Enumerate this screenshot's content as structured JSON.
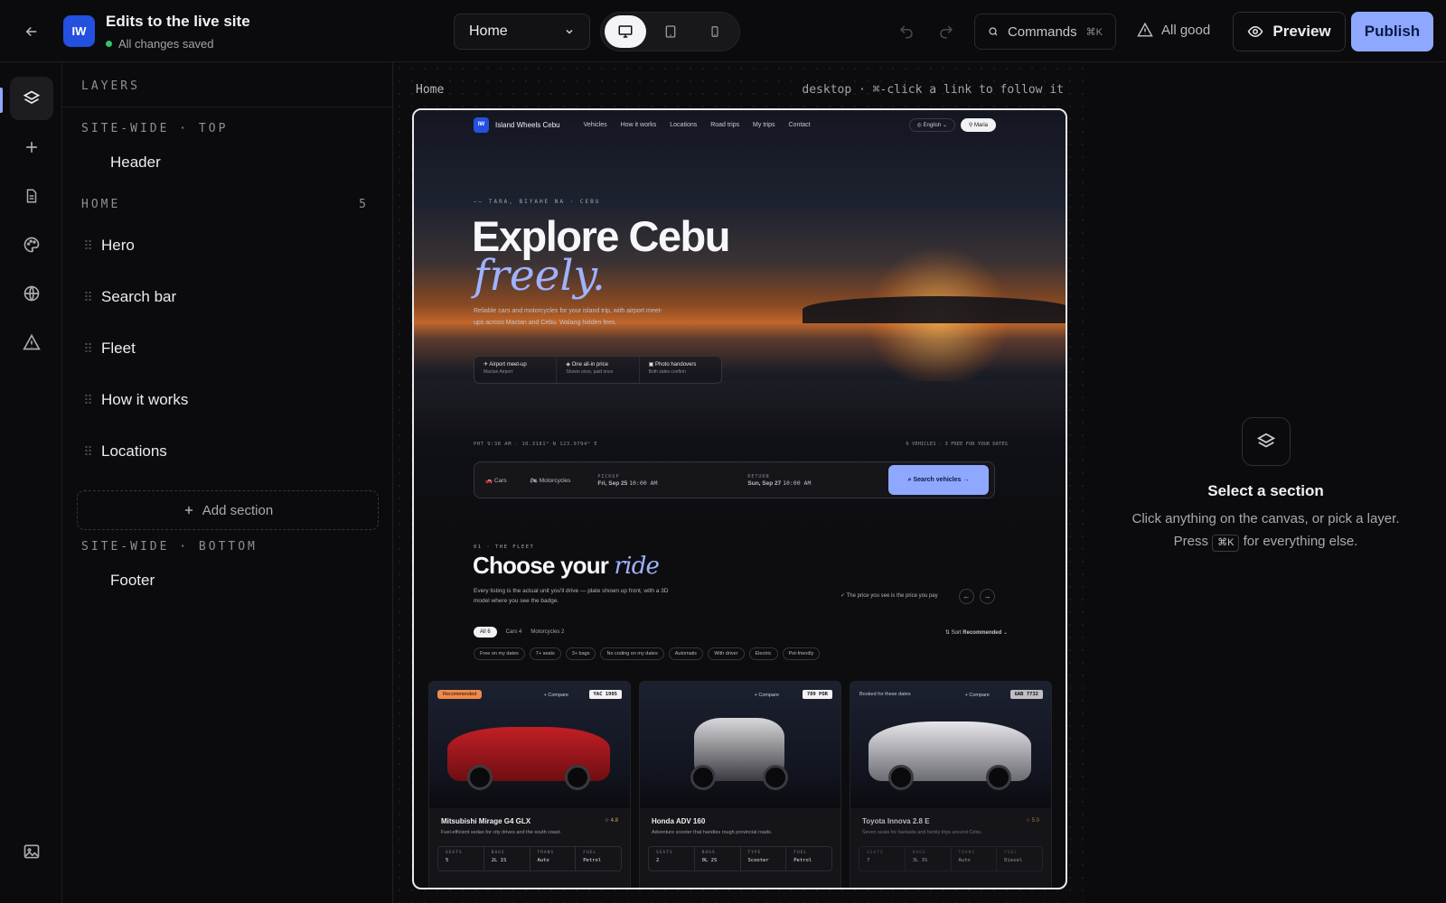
{
  "topbar": {
    "site_logo": "IW",
    "title": "Edits to the live site",
    "status": "All changes saved",
    "page_select": "Home",
    "commands_label": "Commands",
    "commands_shortcut": "⌘K",
    "health": "All good",
    "preview_label": "Preview",
    "publish_label": "Publish"
  },
  "layers": {
    "heading": "LAYERS",
    "top_group": "SITE-WIDE · TOP",
    "top_items": [
      "Header"
    ],
    "home_group": "HOME",
    "home_count": "5",
    "home_items": [
      "Hero",
      "Search bar",
      "Fleet",
      "How it works",
      "Locations"
    ],
    "add_section": "Add section",
    "bottom_group": "SITE-WIDE · BOTTOM",
    "bottom_items": [
      "Footer"
    ]
  },
  "canvas": {
    "breadcrumb": "Home",
    "hint": "desktop · ⌘-click a link to follow it"
  },
  "site": {
    "logo": "IW",
    "brand": "Island Wheels Cebu",
    "nav": [
      "Vehicles",
      "How it works",
      "Locations",
      "Road trips",
      "My trips",
      "Contact"
    ],
    "lang": "English",
    "user": "Maria",
    "eyebrow": "TARA, BIYAHE NA · CEBU",
    "headline": "Explore Cebu",
    "headline_italic": "freely.",
    "lead": "Reliable cars and motorcycles for your island trip, with airport meet-ups across Mactan and Cebu. Walang hidden fees.",
    "features": [
      {
        "title": "Airport meet-up",
        "sub": "Mactan Airport"
      },
      {
        "title": "One all-in price",
        "sub": "Shown once, paid once"
      },
      {
        "title": "Photo handovers",
        "sub": "Both sides confirm"
      }
    ],
    "coords": "PHT 9:38 AM · 10.3181° N 123.9794° E",
    "availability": "6 VEHICLES · 3 FREE FOR YOUR DATES",
    "search": {
      "tab_cars": "Cars",
      "tab_motorcycles": "Motorcycles",
      "pickup_label": "PICKUP",
      "pickup_value": "Fri, Sep 25",
      "pickup_time": "10:00 AM",
      "return_label": "RETURN",
      "return_value": "Sun, Sep 27",
      "return_time": "10:00 AM",
      "button": "Search vehicles"
    },
    "fleet_eyebrow": "01 · THE FLEET",
    "fleet_title": "Choose your",
    "fleet_title_italic": "ride",
    "fleet_lead": "Every listing is the actual unit you'll drive — plate shown up front, with a 3D model where you see the badge.",
    "price_note": "The price you see is the price you pay",
    "tabs": [
      "All 6",
      "Cars 4",
      "Motorcycles 2"
    ],
    "sort_label": "Sort",
    "sort_value": "Recommended",
    "chips": [
      "Free on my dates",
      "7+ seats",
      "3+ bags",
      "No coding on my dates",
      "Automatic",
      "With driver",
      "Electric",
      "Pet-friendly"
    ],
    "cards": [
      {
        "badge": "Recommended",
        "plate": "YAC 1905",
        "compare": "+ Compare",
        "name": "Mitsubishi Mirage G4 GLX",
        "rating": "4.8",
        "desc": "Fuel-efficient sedan for city drives and the south coast.",
        "specs": [
          {
            "k": "SEATS",
            "v": "5"
          },
          {
            "k": "BAGS",
            "v": "2L 1S"
          },
          {
            "k": "TRANS",
            "v": "Auto"
          },
          {
            "k": "FUEL",
            "v": "Petrol"
          }
        ]
      },
      {
        "badge": "",
        "plate": "789 POR",
        "compare": "+ Compare",
        "name": "Honda ADV 160",
        "rating": "",
        "desc": "Adventure scooter that handles rough provincial roads.",
        "specs": [
          {
            "k": "SEATS",
            "v": "2"
          },
          {
            "k": "BAGS",
            "v": "0L 2S"
          },
          {
            "k": "TYPE",
            "v": "Scooter"
          },
          {
            "k": "FUEL",
            "v": "Petrol"
          }
        ]
      },
      {
        "badge": "Booked for these dates",
        "plate": "GAB 7732",
        "compare": "+ Compare",
        "name": "Toyota Innova 2.8 E",
        "rating": "5.0",
        "desc": "Seven seats for barkada and family trips around Cebu.",
        "specs": [
          {
            "k": "SEATS",
            "v": "7"
          },
          {
            "k": "BAGS",
            "v": "3L 3S"
          },
          {
            "k": "TRANS",
            "v": "Auto"
          },
          {
            "k": "FUEL",
            "v": "Diesel"
          }
        ]
      }
    ]
  },
  "inspector": {
    "title": "Select a section",
    "line1": "Click anything on the canvas, or pick a layer.",
    "line2_pre": "Press",
    "line2_key": "⌘K",
    "line2_post": "for everything else."
  },
  "colors": {
    "accent": "#8fa8ff",
    "brand": "#2450e0",
    "status_ok": "#36c26b",
    "badge": "#f08a4b"
  }
}
